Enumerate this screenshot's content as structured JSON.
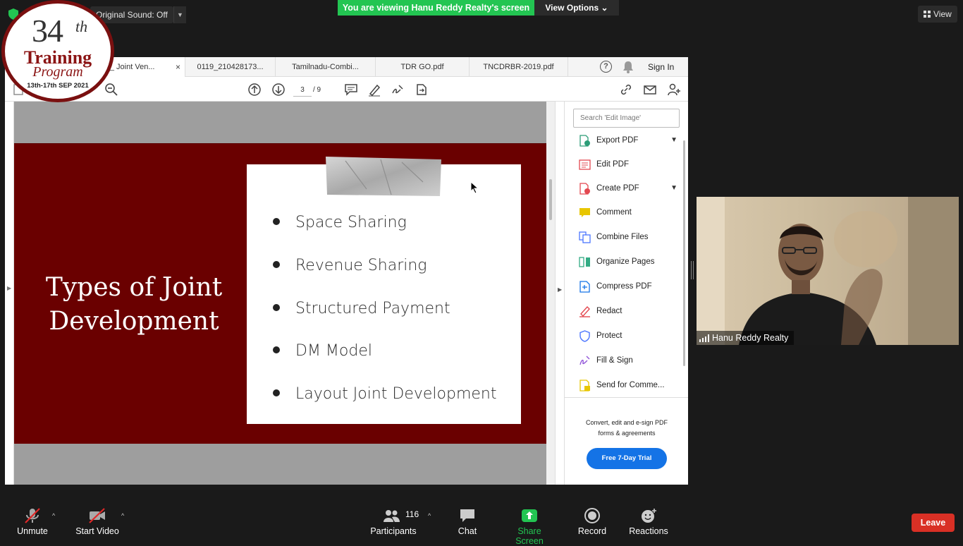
{
  "zoom_top": {
    "original_sound": "Original Sound: Off",
    "viewing_banner": "You are viewing Hanu Reddy Realty's screen",
    "view_options": "View Options",
    "view_button": "View"
  },
  "logo": {
    "number": "34",
    "suffix": "th",
    "line1": "Training",
    "line2": "Program",
    "dates": "13th-17th SEP 2021"
  },
  "acrobat": {
    "tabs": [
      {
        "label": "FTH_ Joint Ven...",
        "active": true
      },
      {
        "label": "0119_210428173...",
        "active": false
      },
      {
        "label": "Tamilnadu-Combi...",
        "active": false
      },
      {
        "label": "TDR GO.pdf",
        "active": false
      },
      {
        "label": "TNCDRBR-2019.pdf",
        "active": false
      }
    ],
    "tab_close": "×",
    "help": "?",
    "sign_in": "Sign In",
    "page_current": "3",
    "page_total": "/ 9",
    "search_placeholder": "Search 'Edit Image'",
    "tools": [
      {
        "label": "Export PDF",
        "icon": "export-pdf-icon",
        "color": "#2d9d78",
        "expand": true
      },
      {
        "label": "Edit PDF",
        "icon": "edit-pdf-icon",
        "color": "#e34850",
        "expand": false
      },
      {
        "label": "Create PDF",
        "icon": "create-pdf-icon",
        "color": "#e34850",
        "expand": true
      },
      {
        "label": "Comment",
        "icon": "comment-icon",
        "color": "#e8c600",
        "expand": false
      },
      {
        "label": "Combine Files",
        "icon": "combine-files-icon",
        "color": "#4b75ff",
        "expand": false
      },
      {
        "label": "Organize Pages",
        "icon": "organize-pages-icon",
        "color": "#33ab84",
        "expand": false
      },
      {
        "label": "Compress PDF",
        "icon": "compress-pdf-icon",
        "color": "#1473e6",
        "expand": false
      },
      {
        "label": "Redact",
        "icon": "redact-icon",
        "color": "#e34850",
        "expand": false
      },
      {
        "label": "Protect",
        "icon": "protect-icon",
        "color": "#4b75ff",
        "expand": false
      },
      {
        "label": "Fill & Sign",
        "icon": "fill-sign-icon",
        "color": "#9256d9",
        "expand": false
      },
      {
        "label": "Send for Comme...",
        "icon": "send-for-comment-icon",
        "color": "#e8c600",
        "expand": false
      }
    ],
    "promo": "Convert, edit and e-sign PDF forms & agreements",
    "trial_button": "Free 7-Day Trial"
  },
  "slide": {
    "title_line1": "Types of Joint",
    "title_line2": "Development",
    "bullets": [
      "Space Sharing",
      "Revenue Sharing",
      "Structured Payment",
      "DM Model",
      "Layout Joint Development"
    ],
    "background": "#6a0000"
  },
  "video": {
    "participant_name": "Hanu Reddy Realty"
  },
  "bottom_bar": {
    "unmute": "Unmute",
    "start_video": "Start Video",
    "participants": "Participants",
    "participants_count": "116",
    "chat": "Chat",
    "share_screen": "Share Screen",
    "record": "Record",
    "reactions": "Reactions",
    "leave": "Leave",
    "share_color": "#23c552",
    "leave_color": "#d93025"
  }
}
